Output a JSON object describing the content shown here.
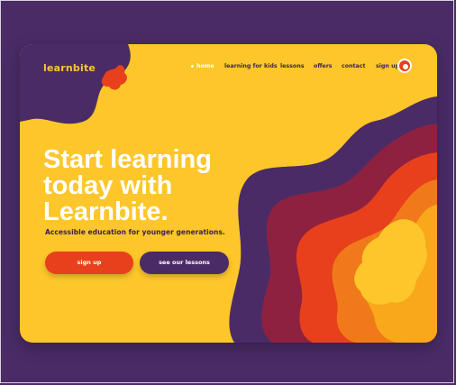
{
  "brand": {
    "logo": "learnbite"
  },
  "nav": {
    "items": [
      {
        "label": "home",
        "active": true
      },
      {
        "label": "learning for kids",
        "active": false
      },
      {
        "label": "lessons",
        "active": false
      },
      {
        "label": "offers",
        "active": false
      },
      {
        "label": "contact",
        "active": false
      },
      {
        "label": "sign up",
        "active": false
      }
    ]
  },
  "hero": {
    "headline": [
      "Start learning",
      "today with",
      "Learnbite."
    ],
    "subtitle": "Accessible education for younger generations.",
    "primary_button": "sign up",
    "secondary_button": "see our lessons"
  },
  "colors": {
    "background": "#4a2b66",
    "card": "#fdc62a",
    "accent": "#e8401c",
    "purple": "#4a2b66",
    "text_dark": "#3b1f55",
    "white": "#ffffff"
  }
}
